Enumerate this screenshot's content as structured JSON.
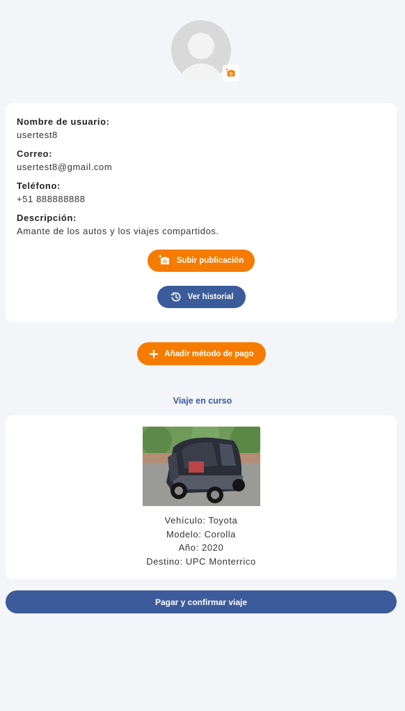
{
  "profile": {
    "username_label": "Nombre de usuario:",
    "username": "usertest8",
    "email_label": "Correo:",
    "email": "usertest8@gmail.com",
    "phone_label": "Teléfono:",
    "phone": "+51 888888888",
    "description_label": "Descripción:",
    "description": "Amante de los autos y los viajes compartidos."
  },
  "actions": {
    "upload_post": "Subir publicación",
    "view_history": "Ver historial",
    "add_payment": "Añadir método de pago"
  },
  "trip": {
    "section_title": "Viaje en curso",
    "vehicle": "Vehículo: Toyota",
    "model": "Modelo: Corolla",
    "year": "Año: 2020",
    "destination": "Destino: UPC Monterrico"
  },
  "pay_button": "Pagar y confirmar viaje",
  "colors": {
    "accent_orange": "#f57c00",
    "accent_blue": "#3b5b9a",
    "background": "#f3f5f9"
  },
  "icons": {
    "avatar": "default-avatar-icon",
    "avatar_camera": "add-photo-icon",
    "upload": "add-photo-icon",
    "history": "history-icon",
    "add": "plus-icon"
  }
}
